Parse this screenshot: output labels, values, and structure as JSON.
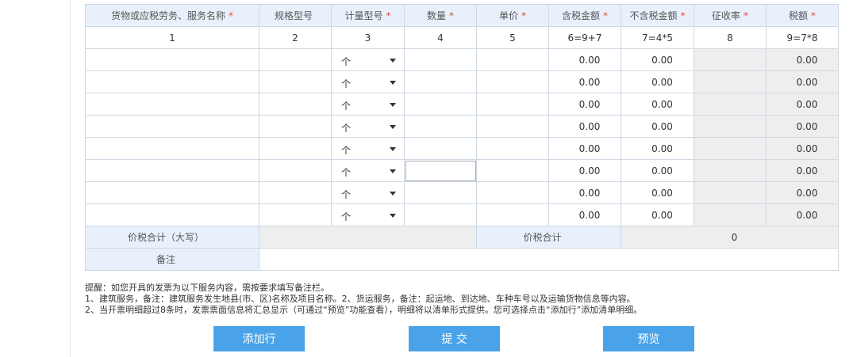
{
  "headers": [
    {
      "label": "货物或应税劳务、服务名称",
      "required": "*"
    },
    {
      "label": "规格型号",
      "required": ""
    },
    {
      "label": "计量型号",
      "required": "*"
    },
    {
      "label": "数量",
      "required": "*"
    },
    {
      "label": "单价",
      "required": "*"
    },
    {
      "label": "含税金额",
      "required": "*"
    },
    {
      "label": "不含税金额",
      "required": "*"
    },
    {
      "label": "征收率",
      "required": "*"
    },
    {
      "label": "税额",
      "required": "*"
    }
  ],
  "index_row": [
    "1",
    "2",
    "3",
    "4",
    "5",
    "6=9+7",
    "7=4*5",
    "8",
    "9=7*8"
  ],
  "rows": [
    {
      "unit": "个",
      "tax_incl": "0.00",
      "tax_excl": "0.00",
      "tax": "0.00"
    },
    {
      "unit": "个",
      "tax_incl": "0.00",
      "tax_excl": "0.00",
      "tax": "0.00"
    },
    {
      "unit": "个",
      "tax_incl": "0.00",
      "tax_excl": "0.00",
      "tax": "0.00"
    },
    {
      "unit": "个",
      "tax_incl": "0.00",
      "tax_excl": "0.00",
      "tax": "0.00"
    },
    {
      "unit": "个",
      "tax_incl": "0.00",
      "tax_excl": "0.00",
      "tax": "0.00"
    },
    {
      "unit": "个",
      "tax_incl": "0.00",
      "tax_excl": "0.00",
      "tax": "0.00"
    },
    {
      "unit": "个",
      "tax_incl": "0.00",
      "tax_excl": "0.00",
      "tax": "0.00"
    },
    {
      "unit": "个",
      "tax_incl": "0.00",
      "tax_excl": "0.00",
      "tax": "0.00"
    }
  ],
  "totals": {
    "uppercase_label": "价税合计（大写）",
    "sum_label": "价税合计",
    "sum_value": "0",
    "remark_label": "备注"
  },
  "notes": [
    "提醒：如您开具的发票为以下服务内容，需按要求填写备注栏。",
    "1、建筑服务，备注：建筑服务发生地县(市、区)名称及项目名称。2、货运服务，备注：起运地、到达地、车种车号以及运输货物信息等内容。",
    "2、当开票明细超过8条时，发票票面信息将汇总显示（可通过“预览”功能查看），明细将以清单形式提供。您可选择点击“添加行”添加清单明细。"
  ],
  "buttons": {
    "add_row": "添加行",
    "submit": "提 交",
    "preview": "预览"
  },
  "colors": {
    "header_bg": "#e8f1fb",
    "required": "#e74c3c",
    "button": "#4aa3e8",
    "readonly_bg": "#eeeeee"
  },
  "icons": {
    "dropdown": "caret-down-icon"
  }
}
